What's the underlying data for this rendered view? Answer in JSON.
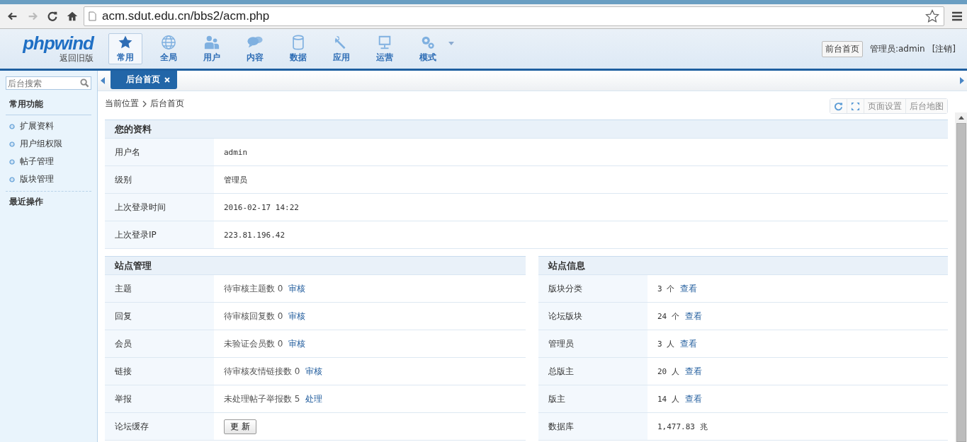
{
  "browser": {
    "url": "acm.sdut.edu.cn/bbs2/acm.php"
  },
  "header": {
    "logo": "phpwind",
    "old_version_link": "返回旧版",
    "nav": [
      {
        "label": "常用",
        "selected": true
      },
      {
        "label": "全局",
        "selected": false
      },
      {
        "label": "用户",
        "selected": false
      },
      {
        "label": "内容",
        "selected": false
      },
      {
        "label": "数据",
        "selected": false
      },
      {
        "label": "应用",
        "selected": false
      },
      {
        "label": "运营",
        "selected": false
      },
      {
        "label": "模式",
        "selected": false
      }
    ],
    "front_page_button": "前台首页",
    "user": "管理员:admin",
    "logout_link": "[注销]"
  },
  "tabs": [
    {
      "label": "后台首页",
      "selected": true
    }
  ],
  "sidebar": {
    "search": {
      "placeholder": "后台搜索"
    },
    "section_title": "常用功能",
    "items": [
      "扩展资料",
      "用户组权限",
      "帖子管理",
      "版块管理"
    ],
    "recent_title": "最近操作"
  },
  "breadcrumb": [
    "当前位置",
    "后台首页"
  ],
  "toolbar": [
    "页面设置",
    "后台地图"
  ],
  "profile": {
    "title": "您的资料",
    "rows": [
      {
        "label": "用户名",
        "value": "admin"
      },
      {
        "label": "级别",
        "value": "管理员"
      },
      {
        "label": "上次登录时间",
        "value": "2016-02-17 14:22"
      },
      {
        "label": "上次登录IP",
        "value": "223.81.196.42"
      }
    ]
  },
  "site_management": {
    "title": "站点管理",
    "rows": [
      {
        "label": "主题",
        "kind": "link",
        "value": "待审核主题数 0",
        "action": "审核"
      },
      {
        "label": "回复",
        "kind": "link",
        "value": "待审核回复数 0",
        "action": "审核"
      },
      {
        "label": "会员",
        "kind": "link",
        "value": "未验证会员数 0",
        "action": "审核"
      },
      {
        "label": "链接",
        "kind": "link",
        "value": "待审核友情链接数 0",
        "action": "审核"
      },
      {
        "label": "举报",
        "kind": "link",
        "value": "未处理帖子举报数 5",
        "action": "处理"
      },
      {
        "label": "论坛缓存",
        "kind": "button",
        "action": "更 新"
      }
    ]
  },
  "site_info": {
    "title": "站点信息",
    "rows": [
      {
        "label": "版块分类",
        "value": "3 个",
        "action": "查看"
      },
      {
        "label": "论坛版块",
        "value": "24 个",
        "action": "查看"
      },
      {
        "label": "管理员",
        "value": "3 人",
        "action": "查看"
      },
      {
        "label": "总版主",
        "value": "20 人",
        "action": "查看"
      },
      {
        "label": "版主",
        "value": "14 人",
        "action": "查看"
      },
      {
        "label": "数据库",
        "value": "1,477.83 兆"
      }
    ]
  }
}
